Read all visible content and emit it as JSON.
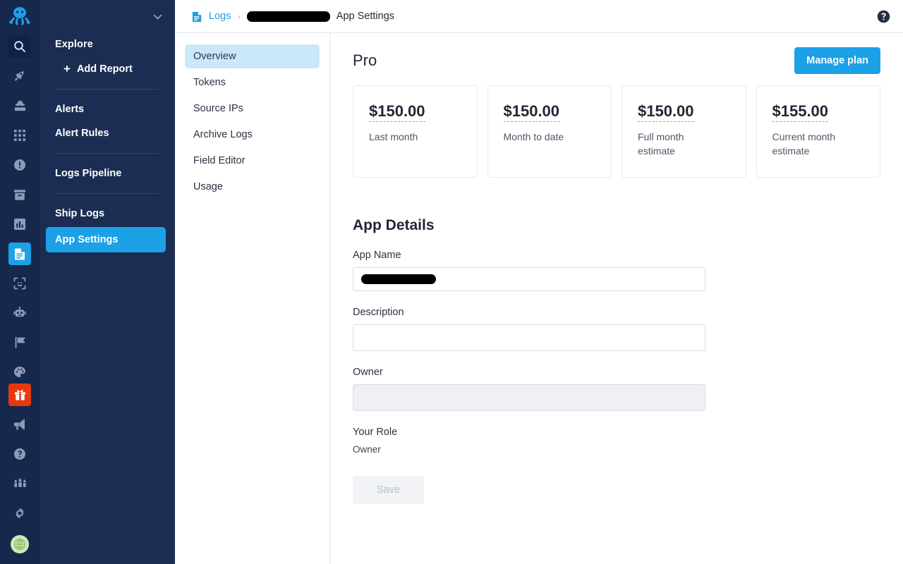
{
  "rail": {
    "logo_icon": "octopus-logo-icon",
    "icons": [
      {
        "name": "search-icon",
        "state": "search"
      },
      {
        "name": "rocket-icon",
        "state": "normal"
      },
      {
        "name": "detective-icon",
        "state": "normal"
      },
      {
        "name": "grid-apps-icon",
        "state": "normal"
      },
      {
        "name": "alert-circle-icon",
        "state": "normal"
      },
      {
        "name": "archive-box-icon",
        "state": "normal"
      },
      {
        "name": "bar-chart-icon",
        "state": "normal"
      },
      {
        "name": "logs-document-icon",
        "state": "active"
      },
      {
        "name": "scan-face-icon",
        "state": "normal"
      },
      {
        "name": "robot-icon",
        "state": "normal"
      },
      {
        "name": "flag-icon",
        "state": "normal"
      },
      {
        "name": "palette-icon",
        "state": "normal"
      }
    ],
    "bottom_icons": [
      {
        "name": "gift-icon",
        "state": "gift"
      },
      {
        "name": "megaphone-icon",
        "state": "normal"
      },
      {
        "name": "help-circle-icon",
        "state": "normal"
      },
      {
        "name": "team-people-icon",
        "state": "normal"
      },
      {
        "name": "gear-icon",
        "state": "normal"
      }
    ],
    "avatar_icon": "user-avatar-globe-icon"
  },
  "sidebar": {
    "collapse_icon": "chevron-down-icon",
    "groups": [
      {
        "heading": "Explore",
        "items": [
          {
            "label": "Add Report",
            "icon": "plus-icon",
            "indent": true
          }
        ]
      },
      {
        "items": [
          {
            "label": "Alerts"
          },
          {
            "label": "Alert Rules"
          }
        ]
      },
      {
        "items": [
          {
            "label": "Logs Pipeline"
          }
        ]
      },
      {
        "items": [
          {
            "label": "Ship Logs"
          }
        ]
      }
    ],
    "active_item": "App Settings"
  },
  "topbar": {
    "breadcrumb_icon": "logs-document-icon",
    "crumb_logs": "Logs",
    "separator": "›",
    "crumb_app_redacted": true,
    "crumb_current": "App Settings",
    "help_icon": "help-circle-icon"
  },
  "subnav": {
    "items": [
      {
        "label": "Overview",
        "active": true
      },
      {
        "label": "Tokens",
        "active": false
      },
      {
        "label": "Source IPs",
        "active": false
      },
      {
        "label": "Archive Logs",
        "active": false
      },
      {
        "label": "Field Editor",
        "active": false
      },
      {
        "label": "Usage",
        "active": false
      }
    ]
  },
  "content": {
    "plan_name": "Pro",
    "manage_plan_label": "Manage plan",
    "cards": [
      {
        "value": "$150.00",
        "label": "Last month"
      },
      {
        "value": "$150.00",
        "label": "Month to date"
      },
      {
        "value": "$150.00",
        "label": "Full month estimate"
      },
      {
        "value": "$155.00",
        "label": "Current month estimate"
      }
    ],
    "app_details": {
      "title": "App Details",
      "app_name_label": "App Name",
      "app_name_value_redacted": true,
      "description_label": "Description",
      "description_value": "",
      "description_placeholder": "",
      "owner_label": "Owner",
      "owner_value": "",
      "your_role_label": "Your Role",
      "your_role_value": "Owner",
      "save_label": "Save"
    }
  },
  "colors": {
    "accent_blue": "#1ca0e6",
    "sidebar_bg": "#1b2d52",
    "rail_bg": "#16294d",
    "subnav_active_bg": "#cbe8fb",
    "gift_red": "#e8380d",
    "avatar_green": "#cfe8b5"
  }
}
